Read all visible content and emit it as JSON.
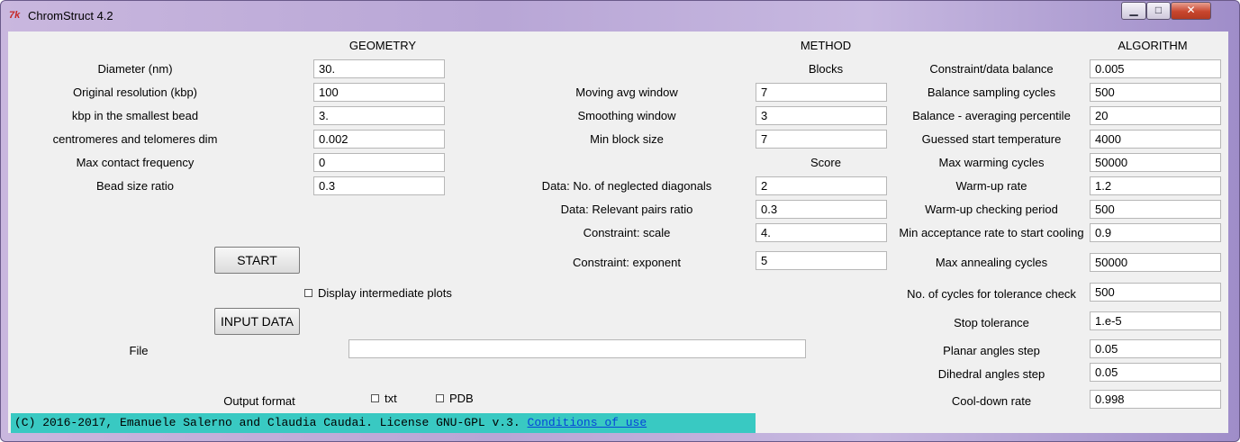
{
  "window": {
    "title": "ChromStruct 4.2",
    "icon_glyph": "7k"
  },
  "sections": {
    "geometry": "GEOMETRY",
    "method": "METHOD",
    "algorithm": "ALGORITHM",
    "blocks": "Blocks",
    "score": "Score"
  },
  "geometry": [
    {
      "label": "Diameter (nm)",
      "value": "30."
    },
    {
      "label": "Original resolution (kbp)",
      "value": "100"
    },
    {
      "label": "kbp in the smallest bead",
      "value": "3."
    },
    {
      "label": "centromeres and telomeres dim",
      "value": "0.002"
    },
    {
      "label": "Max contact frequency",
      "value": "0"
    },
    {
      "label": "Bead size ratio",
      "value": "0.3"
    }
  ],
  "method_blocks": [
    {
      "label": "Moving avg window",
      "value": "7"
    },
    {
      "label": "Smoothing window",
      "value": "3"
    },
    {
      "label": "Min block size",
      "value": "7"
    }
  ],
  "method_score": [
    {
      "label": "Data: No. of neglected diagonals",
      "value": "2"
    },
    {
      "label": "Data: Relevant pairs ratio",
      "value": "0.3"
    },
    {
      "label": "Constraint: scale",
      "value": "4."
    },
    {
      "label": "Constraint: exponent",
      "value": "5"
    }
  ],
  "algorithm": [
    {
      "label": "Constraint/data balance",
      "value": "0.005"
    },
    {
      "label": "Balance sampling cycles",
      "value": "500"
    },
    {
      "label": "Balance - averaging percentile",
      "value": "20"
    },
    {
      "label": "Guessed start temperature",
      "value": "4000"
    },
    {
      "label": "Max warming cycles",
      "value": "50000"
    },
    {
      "label": "Warm-up rate",
      "value": "1.2"
    },
    {
      "label": "Warm-up checking period",
      "value": "500"
    },
    {
      "label": "Min acceptance rate to start cooling",
      "value": "0.9"
    },
    {
      "label": "Max annealing cycles",
      "value": "50000"
    },
    {
      "label": "No. of cycles for tolerance check",
      "value": "500"
    },
    {
      "label": "Stop tolerance",
      "value": "1.e-5"
    },
    {
      "label": "Planar angles step",
      "value": "0.05"
    },
    {
      "label": "Dihedral angles step",
      "value": "0.05"
    },
    {
      "label": "Cool-down rate",
      "value": "0.998"
    }
  ],
  "controls": {
    "start_label": "START",
    "input_data_label": "INPUT DATA",
    "display_plots_label": "Display intermediate plots",
    "file_label": "File",
    "file_value": "",
    "output_format_label": "Output format",
    "txt_label": "txt",
    "pdb_label": "PDB"
  },
  "footer": {
    "text": "(C) 2016-2017, Emanuele Salerno and Claudia Caudai. License GNU-GPL v.3.",
    "link": "Conditions of use"
  },
  "colors": {
    "footer_bg": "#39c9c2",
    "link": "#0645d8",
    "close_button": "#c8462e"
  }
}
